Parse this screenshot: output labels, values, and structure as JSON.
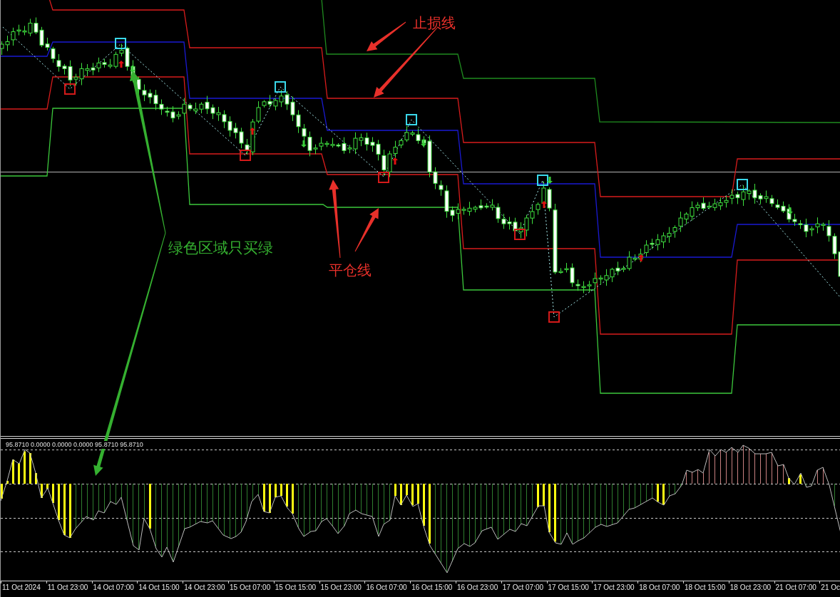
{
  "chart": {
    "annotations": [
      {
        "text": "止损线",
        "color": "#e8302a"
      },
      {
        "text": "平仓线",
        "color": "#e8302a"
      },
      {
        "text": "绿色区域只买绿",
        "color": "#35b030"
      }
    ]
  },
  "indicator": {
    "readout": "95.8710 0.0000 0.0000 0.0000 95.8710 95.8710"
  },
  "time_axis": {
    "labels": [
      "11 Oct 2024",
      "11 Oct 23:00",
      "14 Oct 07:00",
      "14 Oct 15:00",
      "14 Oct 23:00",
      "15 Oct 07:00",
      "15 Oct 15:00",
      "15 Oct 23:00",
      "16 Oct 07:00",
      "16 Oct 15:00",
      "16 Oct 23:00",
      "17 Oct 07:00",
      "17 Oct 15:00",
      "17 Oct 23:00",
      "18 Oct 07:00",
      "18 Oct 15:00",
      "18 Oct 23:00",
      "21 Oct 07:00",
      "21 Oc"
    ]
  }
}
